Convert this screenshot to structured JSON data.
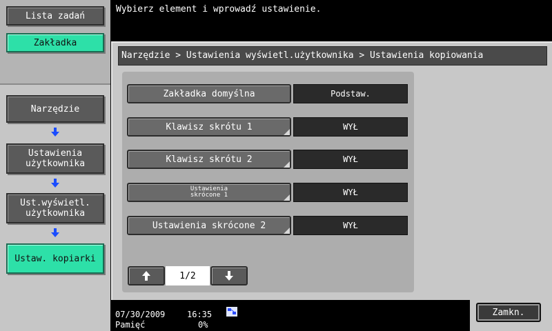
{
  "message": "Wybierz element i wprowadź ustawienie.",
  "sidebar": {
    "job_list": "Lista zadań",
    "tab": "Zakładka",
    "steps": [
      {
        "label": "Narzędzie"
      },
      {
        "label": "Ustawienia\nużytkownika"
      },
      {
        "label": "Ust.wyświetl.\nużytkownika"
      },
      {
        "label": "Ustaw. kopiarki"
      }
    ]
  },
  "breadcrumb": "Narzędzie > Ustawienia wyświetl.użytkownika > Ustawienia kopiowania",
  "settings": [
    {
      "label": "Zakładka domyślna",
      "value": "Podstaw."
    },
    {
      "label": "Klawisz skrótu 1",
      "value": "WYŁ"
    },
    {
      "label": "Klawisz skrótu 2",
      "value": "WYŁ"
    },
    {
      "label": "Ustawienia\nskrócone 1",
      "value": "WYŁ"
    },
    {
      "label": "Ustawienia skrócone 2",
      "value": "WYŁ"
    }
  ],
  "pager": {
    "page": "1/2"
  },
  "status": {
    "date": "07/30/2009",
    "time": "16:35",
    "memory_label": "Pamięć",
    "memory_value": "0%"
  },
  "close_label": "Zamkn."
}
